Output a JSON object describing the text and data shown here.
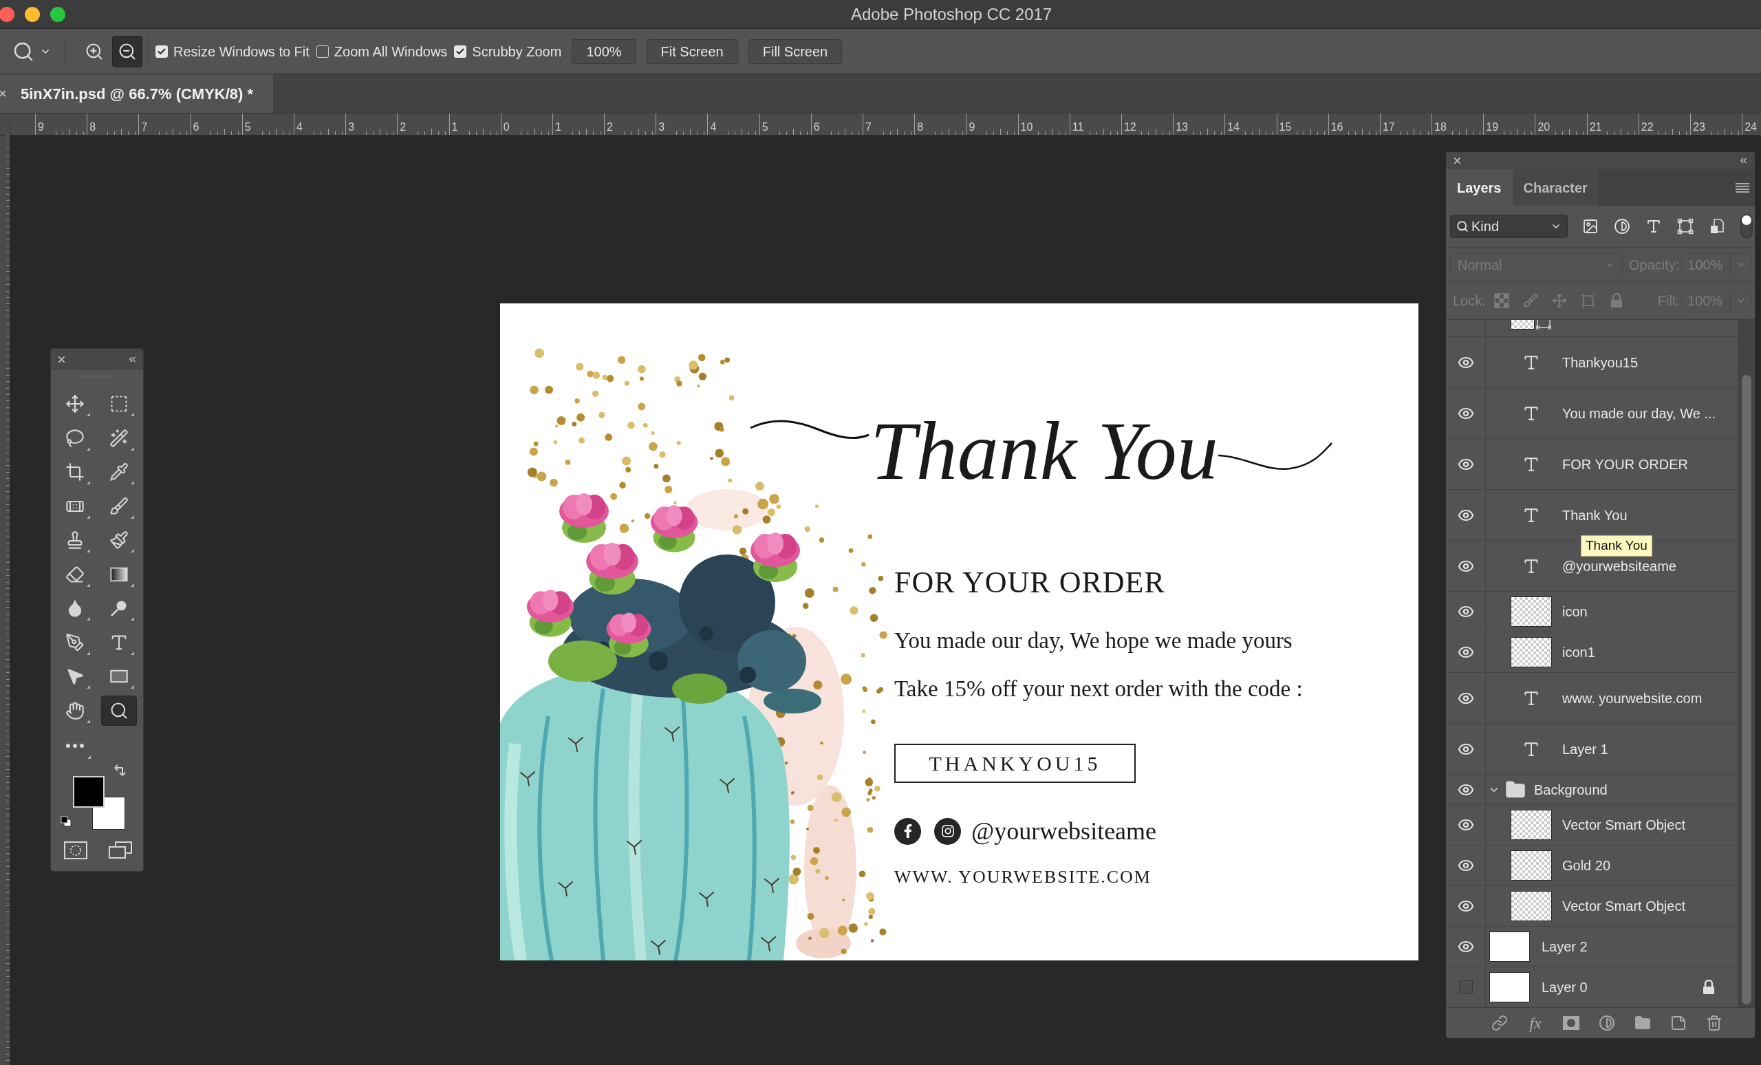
{
  "window": {
    "title": "Adobe Photoshop CC 2017"
  },
  "options_bar": {
    "zoom_buttons": [
      {
        "selected": false
      },
      {
        "selected": true
      }
    ],
    "checkboxes": [
      {
        "label": "Resize Windows to Fit",
        "checked": true
      },
      {
        "label": "Zoom All Windows",
        "checked": false
      },
      {
        "label": "Scrubby Zoom",
        "checked": true
      }
    ],
    "buttons": [
      "100%",
      "Fit Screen",
      "Fill Screen"
    ]
  },
  "document_tab": {
    "title": "5inX7in.psd @ 66.7% (CMYK/8) *"
  },
  "ruler": {
    "labels": [
      "9",
      "8",
      "7",
      "6",
      "5",
      "4",
      "3",
      "2",
      "1",
      "0",
      "1",
      "2",
      "3",
      "4",
      "5",
      "6",
      "7",
      "8",
      "9",
      "10",
      "11",
      "12",
      "13",
      "14",
      "15",
      "16",
      "17",
      "18",
      "19",
      "20",
      "21",
      "22",
      "23",
      "24"
    ]
  },
  "tools_panel": {
    "tools": [
      {
        "selected": false
      },
      {
        "selected": false
      },
      {
        "selected": false
      },
      {
        "selected": false
      },
      {
        "selected": false
      },
      {
        "selected": false
      },
      {
        "selected": false
      },
      {
        "selected": false
      },
      {
        "selected": false
      },
      {
        "selected": false
      },
      {
        "selected": false
      },
      {
        "selected": false
      },
      {
        "selected": false
      },
      {
        "selected": false
      },
      {
        "selected": false
      },
      {
        "selected": false
      },
      {
        "selected": false
      },
      {
        "selected": false
      },
      {
        "selected": false
      },
      {
        "selected": true
      }
    ]
  },
  "document": {
    "heading": "Thank You",
    "subheading": "FOR YOUR ORDER",
    "lines": [
      "You made our day, We hope we made yours",
      "Take 15% off your next order with the code :"
    ],
    "promo_code": "THANKYOU15",
    "social_handle": "@yourwebsiteame",
    "website": "WWW. YOURWEBSITE.COM"
  },
  "layers_panel": {
    "tabs": [
      {
        "label": "Layers",
        "selected": true
      },
      {
        "label": "Character",
        "selected": false
      }
    ],
    "filter": {
      "label": "Kind",
      "on": true
    },
    "blend": {
      "mode": "Normal",
      "opacity_label": "Opacity:",
      "opacity": "100%",
      "disabled": true
    },
    "lock": {
      "label": "Lock:",
      "fill_label": "Fill:",
      "fill": "100%",
      "disabled": true
    },
    "clipped_row": {
      "kind": "shape"
    },
    "layers": [
      {
        "name": "Thankyou15",
        "kind": "text",
        "visible": true,
        "locked": false
      },
      {
        "name": "You made our day, We ...",
        "kind": "text",
        "visible": true,
        "locked": false
      },
      {
        "name": "FOR YOUR ORDER",
        "kind": "text",
        "visible": true,
        "locked": false
      },
      {
        "name": "Thank You",
        "kind": "text",
        "visible": true,
        "locked": false
      },
      {
        "name": "@yourwebsiteame",
        "kind": "text",
        "visible": true,
        "locked": false
      },
      {
        "name": "icon",
        "kind": "image",
        "visible": true,
        "locked": false
      },
      {
        "name": "icon1",
        "kind": "image",
        "visible": true,
        "locked": false
      },
      {
        "name": "www. yourwebsite.com",
        "kind": "text",
        "visible": true,
        "locked": false
      },
      {
        "name": "Layer 1",
        "kind": "text",
        "visible": true,
        "locked": false
      },
      {
        "name": "Background",
        "kind": "group",
        "visible": true,
        "locked": false,
        "expanded": true,
        "children": [
          {
            "name": "Vector Smart Object",
            "kind": "image",
            "visible": true,
            "locked": false
          },
          {
            "name": "Gold 20",
            "kind": "image",
            "visible": true,
            "locked": false
          },
          {
            "name": "Vector Smart Object",
            "kind": "image",
            "visible": true,
            "locked": false
          }
        ]
      },
      {
        "name": "Layer 2",
        "kind": "fill",
        "visible": true,
        "locked": false
      },
      {
        "name": "Layer 0",
        "kind": "fill",
        "visible": false,
        "locked": true
      }
    ],
    "tooltip": "Thank You",
    "footer": {
      "effects_label": "fx"
    }
  }
}
